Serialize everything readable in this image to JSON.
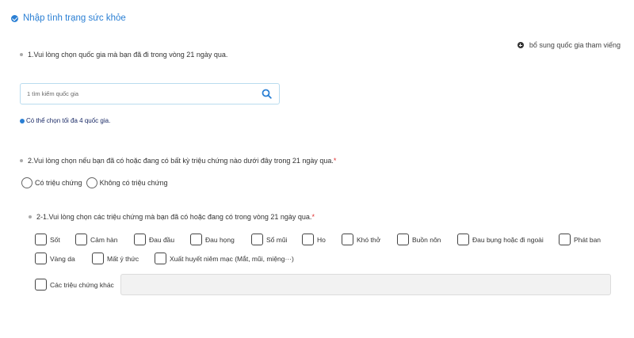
{
  "section": {
    "title": "Nhập tình trạng sức khỏe",
    "icon": "check-circle-icon"
  },
  "add_country": {
    "label": "bổ sung quốc gia tham viếng",
    "icon": "plus-circle-icon"
  },
  "q1": {
    "label": "1.Vui lòng chọn quốc gia mà bạn đã đi trong vòng 21 ngày qua.",
    "search_placeholder": "1 tìm kiếm quốc gia",
    "search_value": "",
    "hint": "Có thể chọn tối đa 4 quốc gia."
  },
  "q2": {
    "label": "2.Vui lòng chọn nếu bạn đã có hoặc đang có bất kỳ triệu chứng nào dưới đây trong 21 ngày qua.",
    "required_mark": "*",
    "options": [
      "Có triệu chứng",
      "Không có triệu chứng"
    ]
  },
  "q21": {
    "label": "2-1.Vui lòng chọn các triệu chứng mà bạn đã có hoặc đang có trong vòng 21 ngày qua.",
    "required_mark": "*",
    "symptoms": [
      "Sốt",
      "Cảm hàn",
      "Đau đầu",
      "Đau họng",
      "Sổ mũi",
      "Ho",
      "Khó thở",
      "Buồn nôn",
      "Đau bụng hoặc đi ngoài",
      "Phát ban",
      "Vàng da",
      "Mất ý thức",
      "Xuất huyết niêm mạc (Mắt, mũi, miệng···)"
    ],
    "other_label": "Các triệu chứng khác",
    "other_value": ""
  }
}
